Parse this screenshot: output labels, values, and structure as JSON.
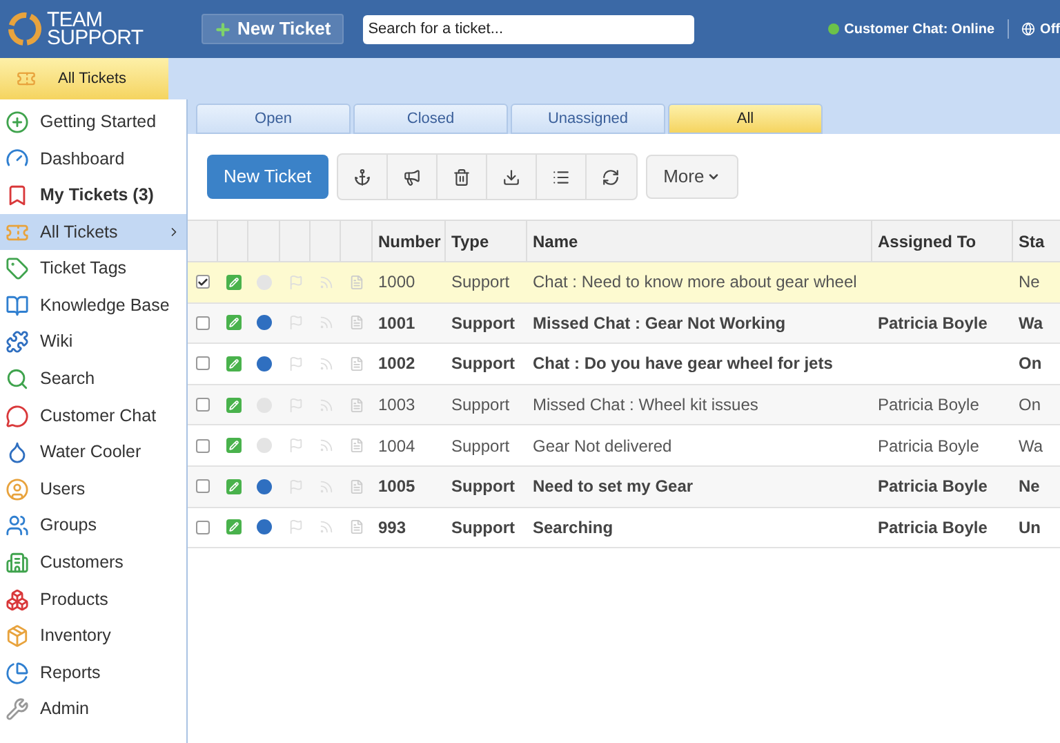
{
  "header": {
    "logo_top": "TEAM",
    "logo_bottom": "SUPPORT",
    "new_ticket": "New Ticket",
    "search": {
      "placeholder": "Search for a ticket..."
    },
    "chat_status": "Customer Chat: Online",
    "status_cut": "Off"
  },
  "page_tab": "All Tickets",
  "sidebar": {
    "items": [
      {
        "label": "Getting Started",
        "selected": false,
        "bold": false
      },
      {
        "label": "Dashboard",
        "selected": false,
        "bold": false
      },
      {
        "label": "My Tickets (3)",
        "selected": false,
        "bold": true
      },
      {
        "label": "All Tickets",
        "selected": true,
        "bold": false
      },
      {
        "label": "Ticket Tags",
        "selected": false,
        "bold": false
      },
      {
        "label": "Knowledge Base",
        "selected": false,
        "bold": false
      },
      {
        "label": "Wiki",
        "selected": false,
        "bold": false
      },
      {
        "label": "Search",
        "selected": false,
        "bold": false
      },
      {
        "label": "Customer Chat",
        "selected": false,
        "bold": false
      },
      {
        "label": "Water Cooler",
        "selected": false,
        "bold": false
      },
      {
        "label": "Users",
        "selected": false,
        "bold": false
      },
      {
        "label": "Groups",
        "selected": false,
        "bold": false
      },
      {
        "label": "Customers",
        "selected": false,
        "bold": false
      },
      {
        "label": "Products",
        "selected": false,
        "bold": false
      },
      {
        "label": "Inventory",
        "selected": false,
        "bold": false
      },
      {
        "label": "Reports",
        "selected": false,
        "bold": false
      },
      {
        "label": "Admin",
        "selected": false,
        "bold": false
      }
    ]
  },
  "tabs": [
    {
      "label": "Open",
      "selected": false
    },
    {
      "label": "Closed",
      "selected": false
    },
    {
      "label": "Unassigned",
      "selected": false
    },
    {
      "label": "All",
      "selected": true
    }
  ],
  "toolbar": {
    "new_ticket": "New Ticket",
    "more": "More"
  },
  "table": {
    "columns": [
      "Number",
      "Type",
      "Name",
      "Assigned To",
      "Sta"
    ],
    "rows": [
      {
        "checked": true,
        "selected": true,
        "unread": false,
        "number": "1000",
        "type": "Support",
        "name": "Chat : Need to know more about gear wheel",
        "assigned": "",
        "status": "Ne"
      },
      {
        "checked": false,
        "selected": false,
        "unread": true,
        "number": "1001",
        "type": "Support",
        "name": "Missed Chat : Gear Not Working",
        "assigned": "Patricia Boyle",
        "status": "Wa"
      },
      {
        "checked": false,
        "selected": false,
        "unread": true,
        "number": "1002",
        "type": "Support",
        "name": "Chat : Do you have gear wheel for jets",
        "assigned": "",
        "status": "On"
      },
      {
        "checked": false,
        "selected": false,
        "unread": false,
        "number": "1003",
        "type": "Support",
        "name": "Missed Chat : Wheel kit issues",
        "assigned": "Patricia Boyle",
        "status": "On"
      },
      {
        "checked": false,
        "selected": false,
        "unread": false,
        "number": "1004",
        "type": "Support",
        "name": "Gear Not delivered",
        "assigned": "Patricia Boyle",
        "status": "Wa"
      },
      {
        "checked": false,
        "selected": false,
        "unread": true,
        "number": "1005",
        "type": "Support",
        "name": "Need to set my Gear",
        "assigned": "Patricia Boyle",
        "status": "Ne"
      },
      {
        "checked": false,
        "selected": false,
        "unread": true,
        "number": "993",
        "type": "Support",
        "name": "Searching",
        "assigned": "Patricia Boyle",
        "status": "Un"
      }
    ]
  }
}
